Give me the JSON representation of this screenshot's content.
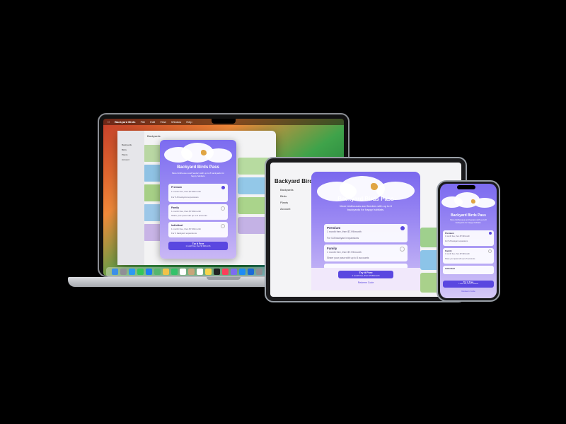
{
  "app": {
    "title": "Backyard Birds Pass",
    "description": "More birdhouses and feeders with up to 8 backyards for happy habitats.",
    "plans": [
      {
        "name": "Premium",
        "price": "1 month free, then $7.99/month",
        "feature": "For 5-8 backyard expansions",
        "selected": true
      },
      {
        "name": "Family",
        "price": "1 month free, then $7.99/month",
        "feature": "Share your pass with up to 5 accounts",
        "selected": false
      },
      {
        "name": "Individual",
        "price": "1 month free, then $7.99/month",
        "feature": "For 3 backyard expansions",
        "selected": false
      }
    ],
    "cta_label": "Try it Free",
    "cta_sub": "1 month free, then $7.99/month",
    "redeem_label": "Redeem Code"
  },
  "mac": {
    "menubar": [
      "Backyard Birds",
      "File",
      "Edit",
      "View",
      "Window",
      "Help"
    ],
    "window_title": "Backyards",
    "sidebar": [
      "Backyards",
      "Birds",
      "Plants",
      "Account"
    ]
  },
  "ipad": {
    "nav_title": "Backyard Birds",
    "sidebar": [
      "Backyards",
      "Birds",
      "Plants",
      "Account"
    ]
  },
  "colors": {
    "accent": "#5a47e0",
    "modal_top": "#7c6cf0",
    "modal_bottom": "#c9b7f5",
    "bird": "#e0a544"
  }
}
